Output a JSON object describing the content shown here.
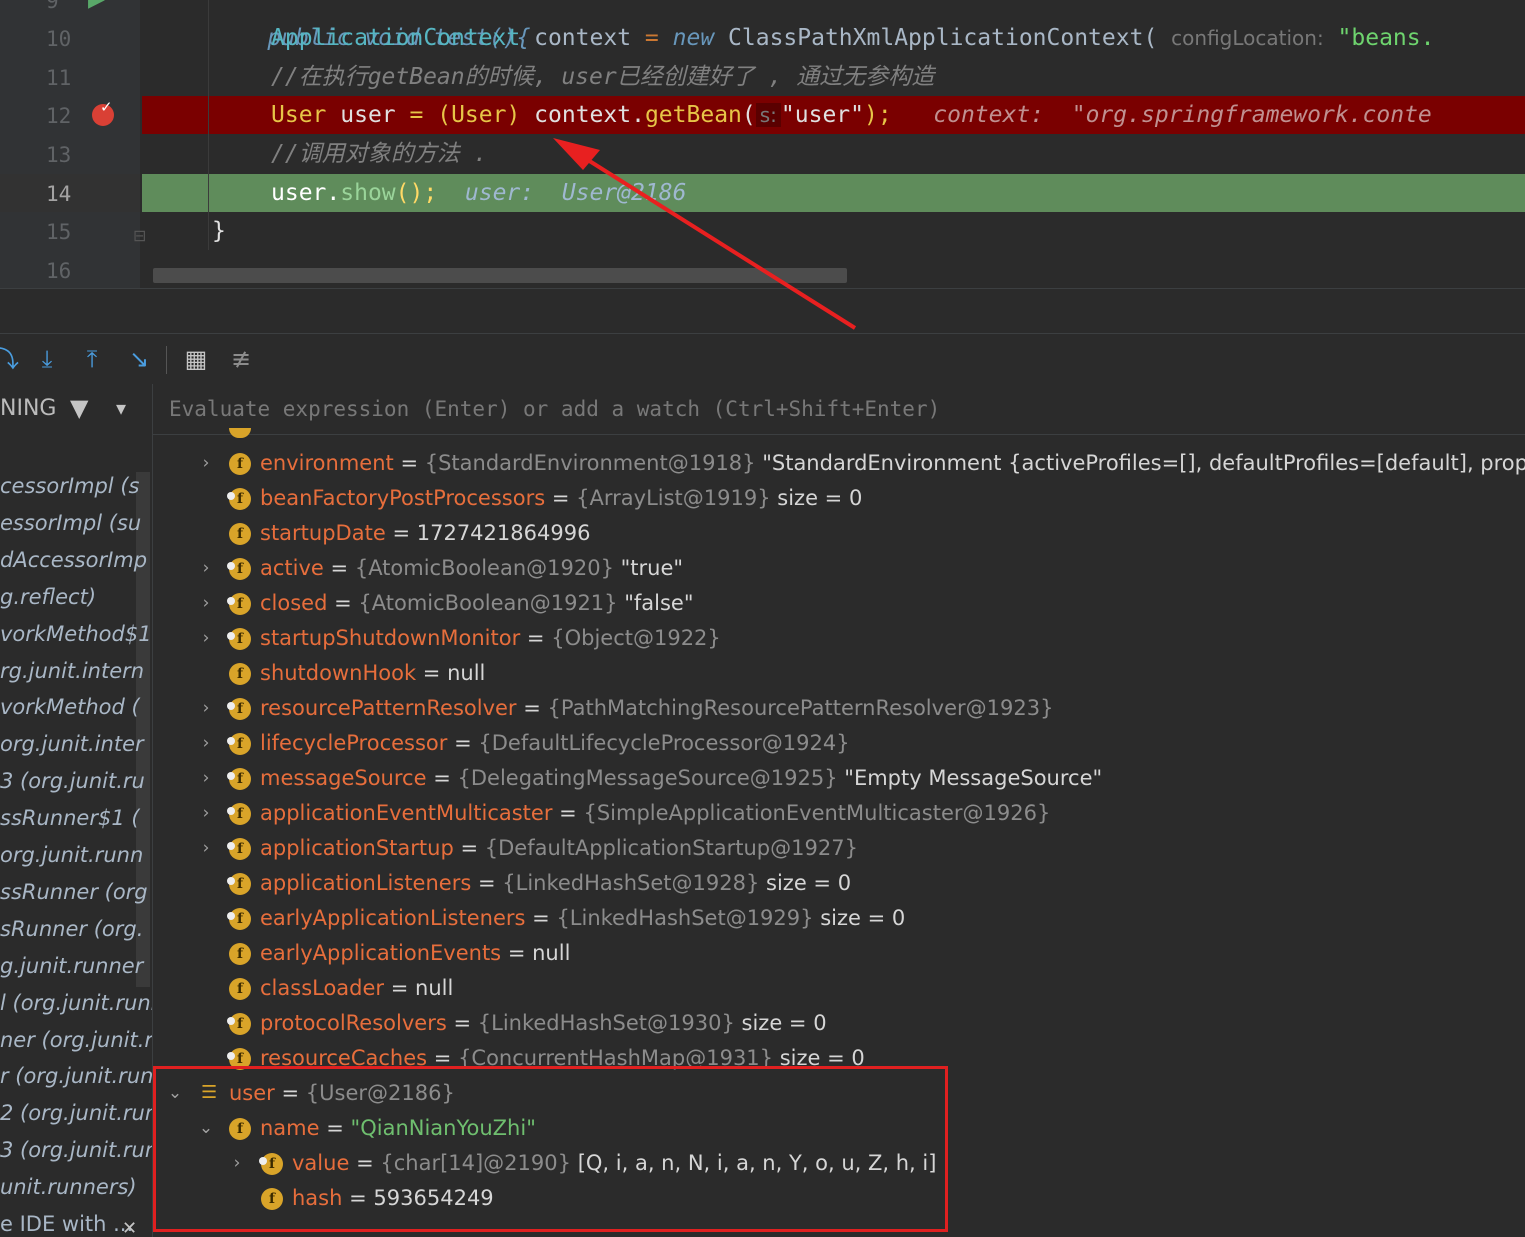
{
  "editor": {
    "lines": [
      {
        "num": "9",
        "text": "public void test(){"
      },
      {
        "num": "10",
        "decl_type": "ApplicationContext",
        "decl_var": "context",
        "new_kw": "new",
        "ctor": "ClassPathXmlApplicationContext(",
        "param_hint": "configLocation:",
        "arg": "\"beans."
      },
      {
        "num": "11",
        "comment": "//在执行getBean的时候, user已经创建好了 , 通过无参构造"
      },
      {
        "num": "12",
        "type": "User",
        "var": "user",
        "eq": "=",
        "cast": "(User)",
        "call": "context.",
        "method": "getBean",
        "paren": "(",
        "hint": "s:",
        "arg": "\"user\"",
        "end": ");",
        "inline": "context:  \"org.springframework.conte"
      },
      {
        "num": "13",
        "comment": "//调用对象的方法 ."
      },
      {
        "num": "14",
        "obj": "user.",
        "method": "show",
        "end": "();",
        "inline": "user:  User@2186"
      },
      {
        "num": "15",
        "text": "}"
      },
      {
        "num": "16",
        "text": ""
      }
    ]
  },
  "debug": {
    "thread_label": "NING",
    "watch_placeholder": "Evaluate expression (Enter) or add a watch (Ctrl+Shift+Enter)",
    "frames": [
      "cessorImpl (s",
      "essorImpl (su",
      "dAccessorImp",
      "g.reflect)",
      "vorkMethod$1",
      "rg.junit.intern",
      "vorkMethod (",
      "org.junit.inter",
      "3 (org.junit.ru",
      "ssRunner$1 (",
      "org.junit.runn",
      "ssRunner (org",
      "sRunner (org.",
      "g.junit.runner",
      "l (org.junit.runr",
      "ner (org.junit.ru",
      "r (org.junit.runr",
      "2 (org.junit.run",
      "3 (org.junit.run",
      "unit.runners)",
      "e IDE with ..."
    ],
    "variables": [
      {
        "name": "environment",
        "type": "{StandardEnvironment@1918}",
        "value": "\"StandardEnvironment {activeProfiles=[], defaultProfiles=[default], propertySou",
        "expand": ">"
      },
      {
        "name": "beanFactoryPostProcessors",
        "type": "{ArrayList@1919}",
        "value": "size = 0",
        "expand": ""
      },
      {
        "name": "startupDate",
        "type": "",
        "value": "1727421864996",
        "expand": ""
      },
      {
        "name": "active",
        "type": "{AtomicBoolean@1920}",
        "value": "\"true\"",
        "expand": ">"
      },
      {
        "name": "closed",
        "type": "{AtomicBoolean@1921}",
        "value": "\"false\"",
        "expand": ">"
      },
      {
        "name": "startupShutdownMonitor",
        "type": "{Object@1922}",
        "value": "",
        "expand": ">"
      },
      {
        "name": "shutdownHook",
        "type": "",
        "value": "null",
        "expand": ""
      },
      {
        "name": "resourcePatternResolver",
        "type": "{PathMatchingResourcePatternResolver@1923}",
        "value": "",
        "expand": ">"
      },
      {
        "name": "lifecycleProcessor",
        "type": "{DefaultLifecycleProcessor@1924}",
        "value": "",
        "expand": ">"
      },
      {
        "name": "messageSource",
        "type": "{DelegatingMessageSource@1925}",
        "value": "\"Empty MessageSource\"",
        "expand": ">"
      },
      {
        "name": "applicationEventMulticaster",
        "type": "{SimpleApplicationEventMulticaster@1926}",
        "value": "",
        "expand": ">"
      },
      {
        "name": "applicationStartup",
        "type": "{DefaultApplicationStartup@1927}",
        "value": "",
        "expand": ">"
      },
      {
        "name": "applicationListeners",
        "type": "{LinkedHashSet@1928}",
        "value": "size = 0",
        "expand": ""
      },
      {
        "name": "earlyApplicationListeners",
        "type": "{LinkedHashSet@1929}",
        "value": "size = 0",
        "expand": ""
      },
      {
        "name": "earlyApplicationEvents",
        "type": "",
        "value": "null",
        "expand": ""
      },
      {
        "name": "classLoader",
        "type": "",
        "value": "null",
        "expand": ""
      },
      {
        "name": "protocolResolvers",
        "type": "{LinkedHashSet@1930}",
        "value": "size = 0",
        "expand": ""
      },
      {
        "name": "resourceCaches",
        "type": "{ConcurrentHashMap@1931}",
        "value": "size = 0",
        "expand": ""
      }
    ],
    "user_var": {
      "name": "user",
      "type": "{User@2186}",
      "expand": "v"
    },
    "name_field": {
      "name": "name",
      "value": "\"QianNianYouZhi\"",
      "expand": "v"
    },
    "value_field": {
      "name": "value",
      "type": "{char[14]@2190}",
      "value": "[Q, i, a, n, N, i, a, n, Y, o, u, Z, h, i]",
      "expand": ">"
    },
    "hash_field": {
      "name": "hash",
      "value": "593654249"
    },
    "eq": "=",
    "icon_letter": "f"
  },
  "colors": {
    "breakpoint_line": "#7a0000",
    "exec_line": "#5f8c5b",
    "highlight_box": "#e02020",
    "annotation_arrow": "#e82020"
  }
}
